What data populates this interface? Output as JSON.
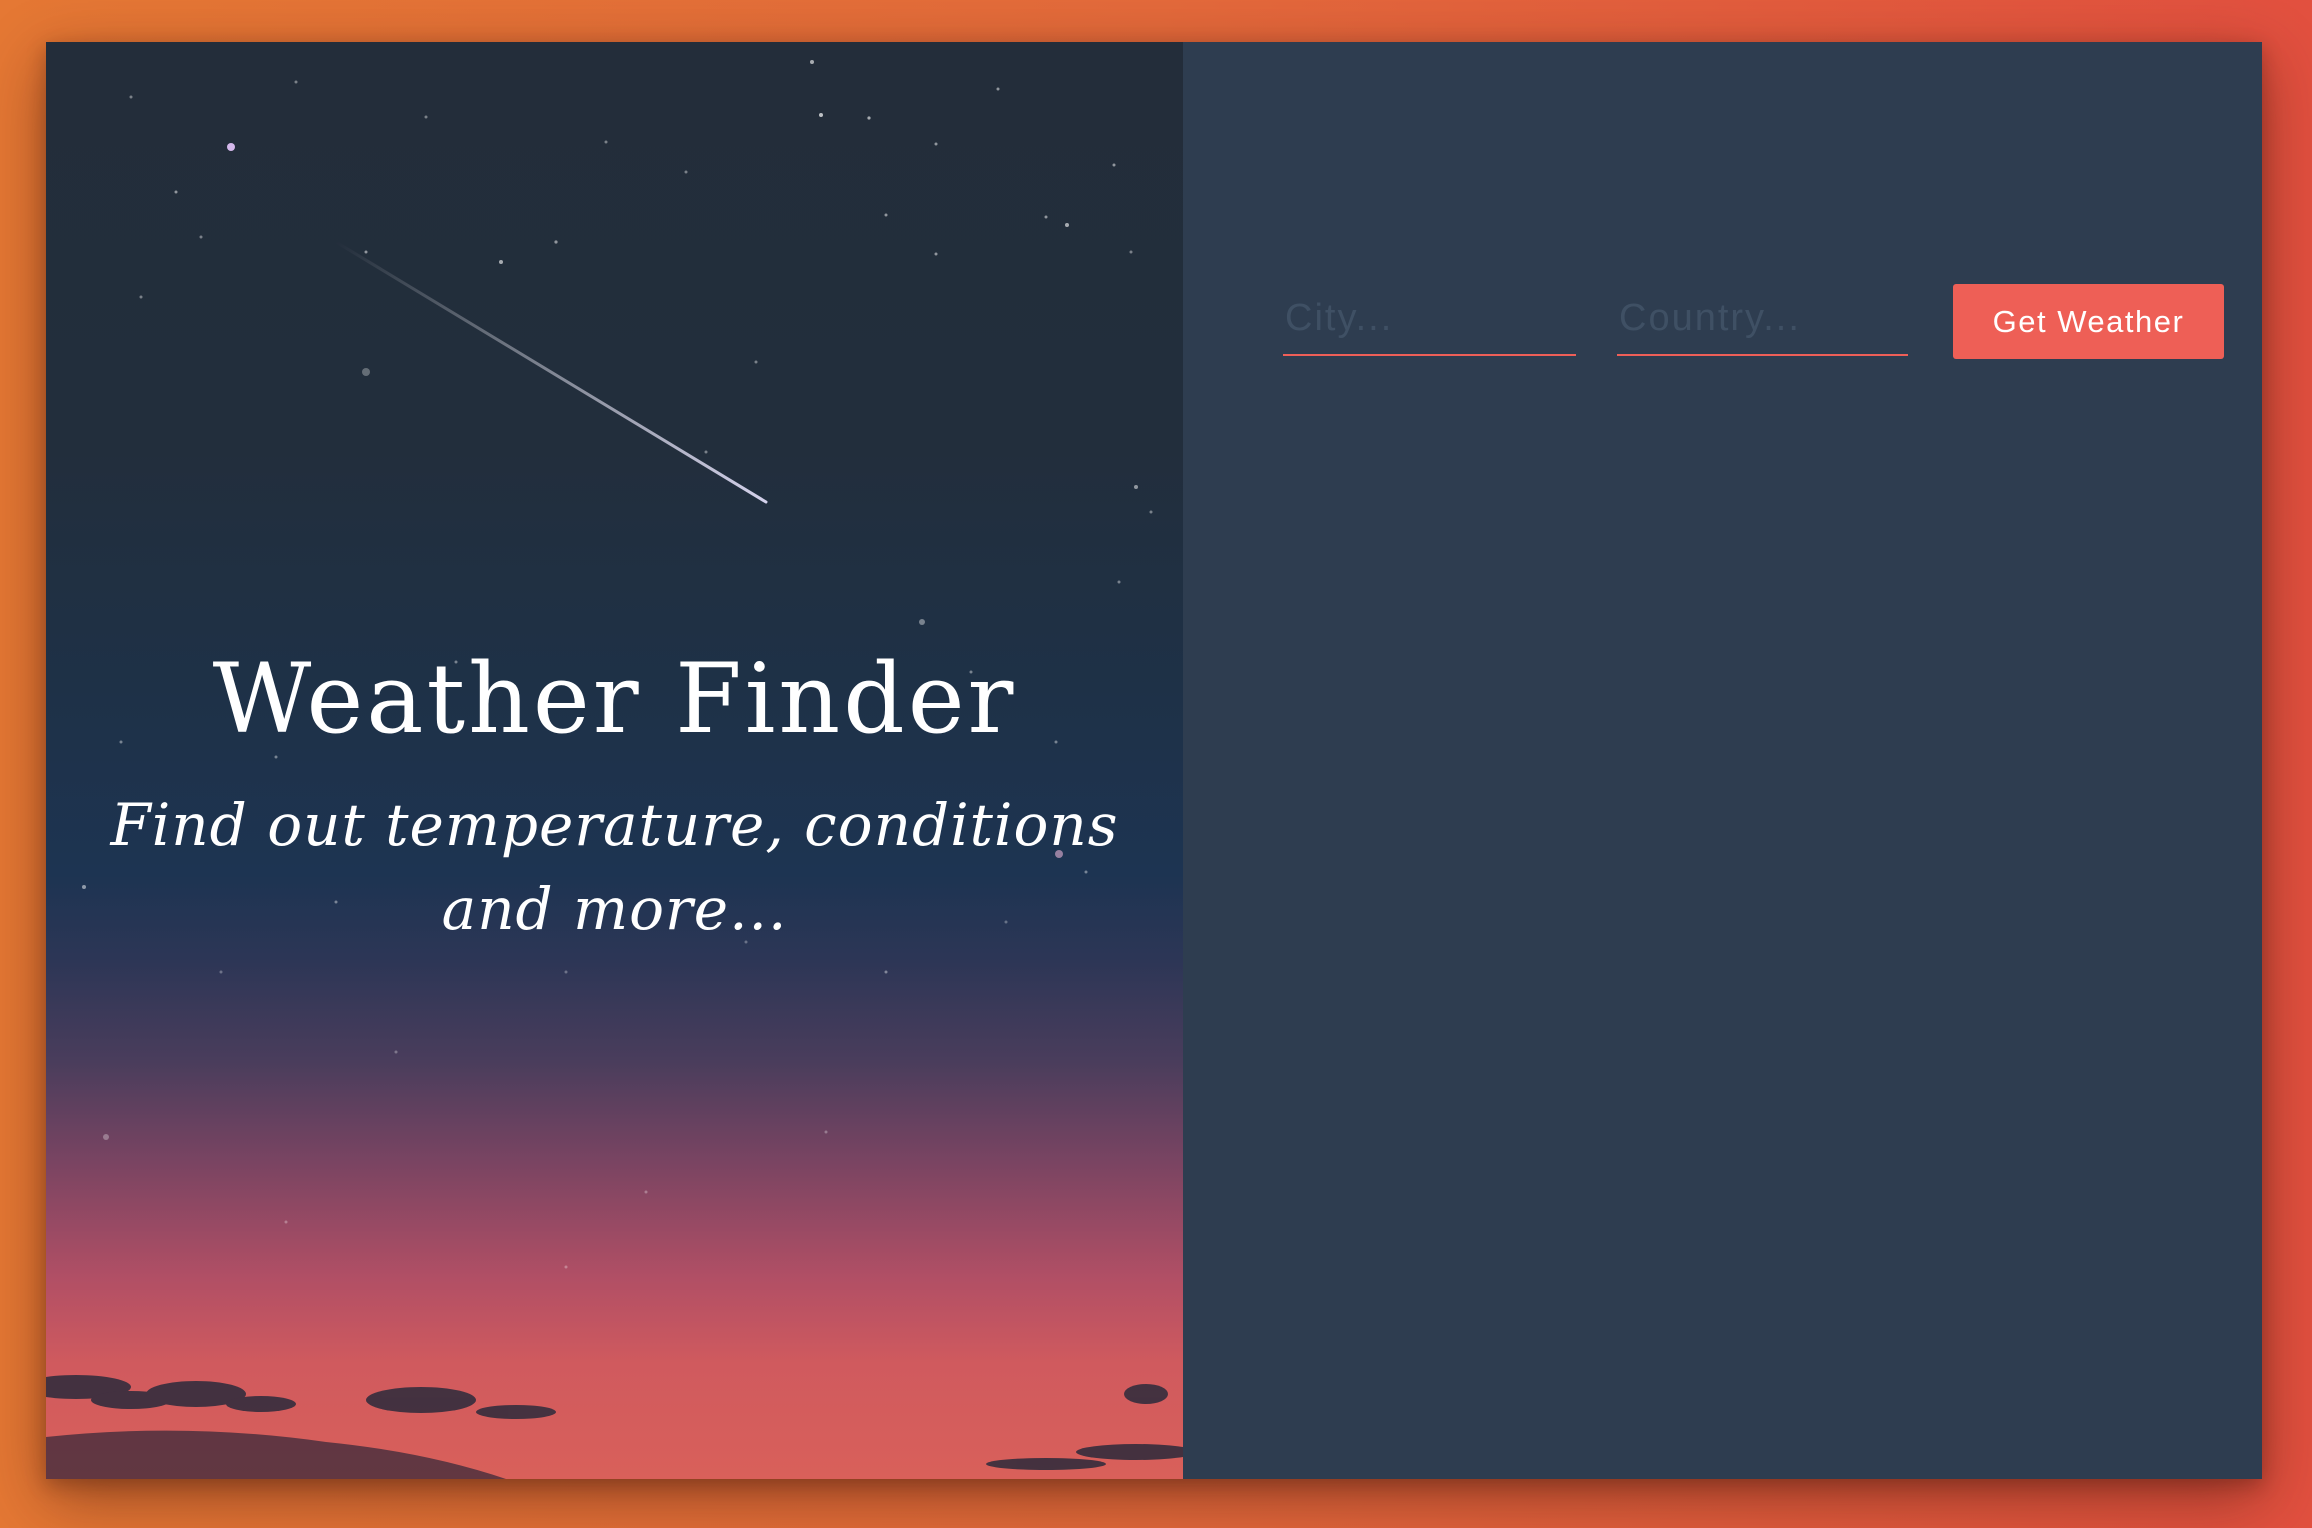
{
  "hero": {
    "title": "Weather Finder",
    "subtitle": "Find out temperature, conditions and more..."
  },
  "form": {
    "city_placeholder": "City...",
    "country_placeholder": "Country...",
    "submit_label": "Get Weather"
  },
  "colors": {
    "page_background": "#e46a3b",
    "form_panel": "#2e3d50",
    "accent": "#ee5f56"
  }
}
